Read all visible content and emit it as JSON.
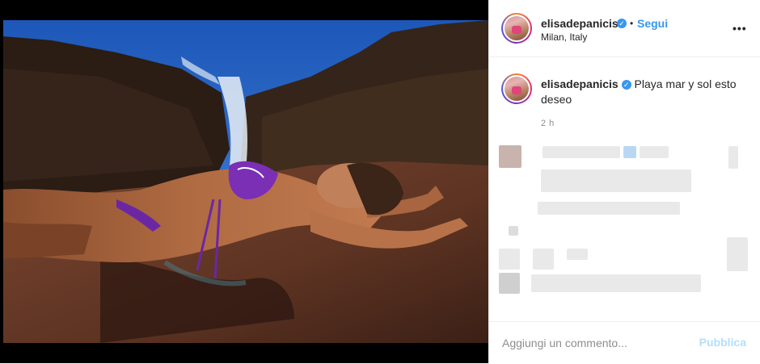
{
  "post": {
    "image_alt": "",
    "header": {
      "username": "elisadepanicis",
      "separator": "•",
      "follow_label": "Segui",
      "location": "Milan, Italy",
      "more_label": "•••"
    },
    "caption": {
      "username": "elisadepanicis",
      "text": "Playa mar y sol esto deseo",
      "time": "2 h"
    },
    "comment_box": {
      "placeholder": "Aggiungi un commento...",
      "publish_label": "Pubblica"
    }
  },
  "icons": {
    "verified": "verified-badge-icon",
    "more": "more-options-icon"
  },
  "colors": {
    "accent_blue": "#3897f0",
    "publish_disabled": "#b2dffc",
    "muted_text": "#8e8e8e",
    "divider": "#efefef"
  }
}
